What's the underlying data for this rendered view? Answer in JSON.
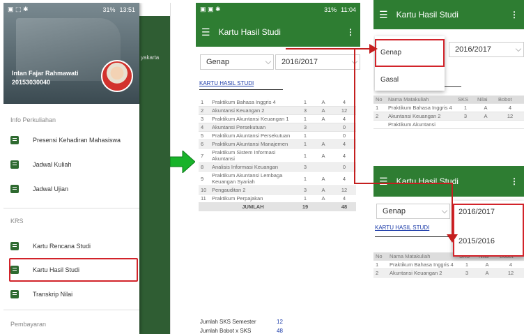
{
  "phone1": {
    "status_time": "13:51",
    "status_battery": "31%",
    "bg_text": "yakarta",
    "user_name": "Intan Fajar Rahmawati",
    "user_id": "20153030040",
    "sections": [
      "Info Perkuliahan",
      "KRS",
      "Pembayaran"
    ],
    "items": [
      {
        "label": "Presensi Kehadiran Mahasiswa",
        "icon": "clipboard-icon"
      },
      {
        "label": "Jadwal Kuliah",
        "icon": "calendar-icon"
      },
      {
        "label": "Jadwal Ujian",
        "icon": "calendar-icon"
      },
      {
        "label": "Kartu Rencana Studi",
        "icon": "document-icon"
      },
      {
        "label": "Kartu Hasil Studi",
        "icon": "check-icon"
      },
      {
        "label": "Transkrip Nilai",
        "icon": "document-icon"
      }
    ]
  },
  "phone2": {
    "status_time": "11:04",
    "status_battery": "31%",
    "title": "Kartu Hasil Studi",
    "semester": "Genap",
    "year": "2016/2017",
    "section_title": "KARTU HASIL STUDI",
    "rows": [
      [
        "1",
        "Praktikum Bahasa Inggris 4",
        "1",
        "A",
        "4"
      ],
      [
        "2",
        "Akuntansi Keuangan 2",
        "3",
        "A",
        "12"
      ],
      [
        "3",
        "Praktikum Akuntansi Keuangan 1",
        "1",
        "A",
        "4"
      ],
      [
        "4",
        "Akuntansi Persekutuan",
        "3",
        "",
        "0"
      ],
      [
        "5",
        "Praktikum Akuntansi Persekutuan",
        "1",
        "",
        "0"
      ],
      [
        "6",
        "Praktikum Akuntansi Manajemen",
        "1",
        "A",
        "4"
      ],
      [
        "7",
        "Praktikum Sistem Informasi Akuntansi",
        "1",
        "A",
        "4"
      ],
      [
        "8",
        "Analisis Informasi Keuangan",
        "3",
        "",
        "0"
      ],
      [
        "9",
        "Praktikum Akuntansi Lembaga Keuangan Syariah",
        "1",
        "A",
        "4"
      ],
      [
        "10",
        "Pengauditan 2",
        "3",
        "A",
        "12"
      ],
      [
        "11",
        "Praktikum Perpajakan",
        "1",
        "A",
        "4"
      ]
    ],
    "total_label": "JUMLAH",
    "total_sks": "19",
    "total_bobot": "48",
    "summary_label": "Jumlah SKS Semester",
    "summary_value": "12",
    "summary2_label": "Jumlah Bobot x SKS",
    "summary2_value": "48"
  },
  "phone3": {
    "title": "Kartu Hasil Studi",
    "options": [
      "Genap",
      "Gasal"
    ],
    "year": "2016/2017",
    "headers": [
      "No",
      "Nama Matakuliah",
      "SKS",
      "Nilai",
      "Bobot"
    ],
    "rows": [
      [
        "1",
        "Praktikum Bahasa Inggris 4",
        "1",
        "A",
        "4"
      ],
      [
        "2",
        "Akuntansi Keuangan 2",
        "3",
        "A",
        "12"
      ],
      [
        "",
        "Praktikum Akuntansi",
        "",
        "",
        ""
      ]
    ]
  },
  "phone4": {
    "title": "Kartu Hasil Studi",
    "semester": "Genap",
    "years": [
      "2016/2017",
      "2015/2016"
    ],
    "section_title": "KARTU HASIL STUDI",
    "headers": [
      "No",
      "Nama Matakuliah",
      "SKS",
      "Nilai",
      "Bobot"
    ],
    "rows": [
      [
        "1",
        "Praktikum Bahasa Inggris 4",
        "1",
        "A",
        "4"
      ],
      [
        "2",
        "Akuntansi Keuangan 2",
        "3",
        "A",
        "12"
      ]
    ]
  },
  "colors": {
    "accent": "#2e7d32",
    "highlight": "#d2232a",
    "arrow": "#18b32a"
  }
}
